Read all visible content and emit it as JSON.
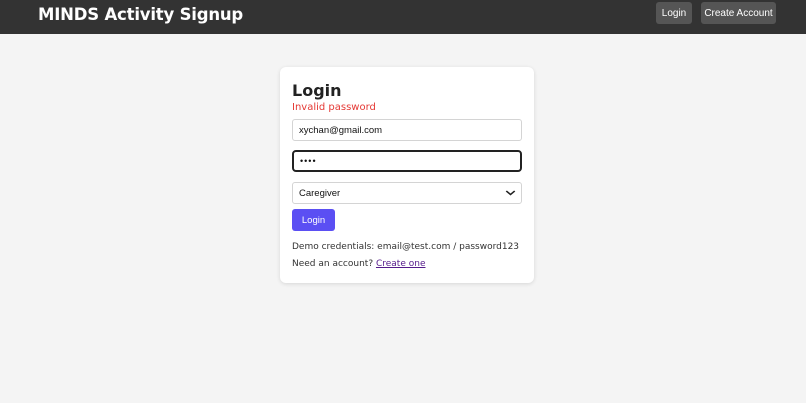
{
  "header": {
    "title": "MINDS Activity Signup",
    "nav": {
      "login_label": "Login",
      "create_account_label": "Create Account"
    }
  },
  "login_card": {
    "title": "Login",
    "error_message": "Invalid password",
    "email": {
      "value": "xychan@gmail.com"
    },
    "password": {
      "masked_value": "••••"
    },
    "role_select": {
      "selected": "Caregiver"
    },
    "submit_label": "Login",
    "demo_credentials": "Demo credentials: email@test.com / password123",
    "signup_prompt": "Need an account?",
    "signup_link": "Create one"
  },
  "colors": {
    "header_bg": "#333333",
    "nav_button_bg": "#555555",
    "page_bg": "#f4f4f4",
    "primary_button": "#5b4ff3",
    "error": "#e53935",
    "link_visited": "#551a8b"
  },
  "icons": {
    "select_chevron": "chevron-down-icon"
  }
}
